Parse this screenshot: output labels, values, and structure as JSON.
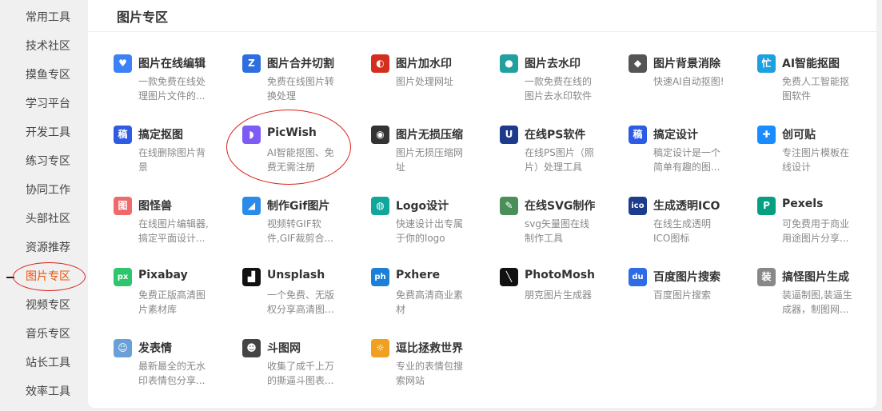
{
  "sidebar": {
    "items": [
      {
        "label": "常用工具"
      },
      {
        "label": "技术社区"
      },
      {
        "label": "摸鱼专区"
      },
      {
        "label": "学习平台"
      },
      {
        "label": "开发工具"
      },
      {
        "label": "练习专区"
      },
      {
        "label": "协同工作"
      },
      {
        "label": "头部社区"
      },
      {
        "label": "资源推荐"
      },
      {
        "label": "图片专区",
        "active": true
      },
      {
        "label": "视频专区"
      },
      {
        "label": "音乐专区"
      },
      {
        "label": "站长工具"
      },
      {
        "label": "效率工具"
      }
    ]
  },
  "panel": {
    "title": "图片专区",
    "cards": [
      {
        "name": "图片在线编辑",
        "desc": "一款免费在线处理图片文件的...",
        "icon": "heart-edit-icon",
        "color": "#3b82f6",
        "glyph": "♥"
      },
      {
        "name": "图片合并切割",
        "desc": "免费在线图片转换处理",
        "icon": "z-logo-icon",
        "color": "#2f6ede",
        "glyph": "Z"
      },
      {
        "name": "图片加水印",
        "desc": "图片处理网址",
        "icon": "red-swirl-icon",
        "color": "#d42f1e",
        "glyph": "◐"
      },
      {
        "name": "图片去水印",
        "desc": "一款免费在线的图片去水印软件",
        "icon": "water-drops-icon",
        "color": "#22a0a0",
        "glyph": "●"
      },
      {
        "name": "图片背景消除",
        "desc": "快速AI自动抠图!",
        "icon": "layers-icon",
        "color": "#555555",
        "glyph": "◆"
      },
      {
        "name": "AI智能抠图",
        "desc": "免费人工智能抠图软件",
        "icon": "ai-cutout-icon",
        "color": "#1ca0e0",
        "glyph": "忙"
      },
      {
        "name": "搞定抠图",
        "desc": "在线删除图片背景",
        "icon": "gaoding-icon",
        "color": "#2d5be3",
        "glyph": "稿"
      },
      {
        "name": "PicWish",
        "desc": "AI智能抠图、免费无需注册",
        "icon": "picwish-icon",
        "color": "#7c5cf5",
        "glyph": "◗"
      },
      {
        "name": "图片无损压缩",
        "desc": "图片无损压缩网址",
        "icon": "panda-icon",
        "color": "#333333",
        "glyph": "◉"
      },
      {
        "name": "在线PS软件",
        "desc": "在线PS图片（照片）处理工具",
        "icon": "ps-icon",
        "color": "#1e3a8a",
        "glyph": "U"
      },
      {
        "name": "搞定设计",
        "desc": "稿定设计是一个简单有趣的图...",
        "icon": "gaoding-design-icon",
        "color": "#2d5be3",
        "glyph": "稿"
      },
      {
        "name": "创可贴",
        "desc": "专注图片模板在线设计",
        "icon": "chuangkit-icon",
        "color": "#1a8cff",
        "glyph": "✚"
      },
      {
        "name": "图怪兽",
        "desc": "在线图片编辑器,搞定平面设计...",
        "icon": "tuguaishou-icon",
        "color": "#ef6b6b",
        "glyph": "图"
      },
      {
        "name": "制作Gif图片",
        "desc": "视频转GIF软件,GIF裁剪合...",
        "icon": "gif-maker-icon",
        "color": "#2b8be8",
        "glyph": "◢"
      },
      {
        "name": "Logo设计",
        "desc": "快速设计出专属于你的logo",
        "icon": "logo-design-icon",
        "color": "#10a69a",
        "glyph": "◍"
      },
      {
        "name": "在线SVG制作",
        "desc": "svg矢量图在线制作工具",
        "icon": "svg-tools-icon",
        "color": "#4a8f5a",
        "glyph": "✎"
      },
      {
        "name": "生成透明ICO",
        "desc": "在线生成透明ICO图标",
        "icon": "ico-icon",
        "color": "#1d3c8c",
        "glyph": "ico"
      },
      {
        "name": "Pexels",
        "desc": "可免费用于商业用途图片分享...",
        "icon": "pexels-icon",
        "color": "#05a081",
        "glyph": "P"
      },
      {
        "name": "Pixabay",
        "desc": "免费正版高清图片素材库",
        "icon": "pixabay-icon",
        "color": "#2ec66d",
        "glyph": "px"
      },
      {
        "name": "Unsplash",
        "desc": "一个免费、无版权分享高清图...",
        "icon": "unsplash-icon",
        "color": "#111111",
        "glyph": "▟"
      },
      {
        "name": "Pxhere",
        "desc": "免费高清商业素材",
        "icon": "pxhere-icon",
        "color": "#1c7fd8",
        "glyph": "ph"
      },
      {
        "name": "PhotoMosh",
        "desc": "朋克图片生成器",
        "icon": "photomosh-icon",
        "color": "#111111",
        "glyph": "╲"
      },
      {
        "name": "百度图片搜索",
        "desc": "百度图片搜索",
        "icon": "baidu-paw-icon",
        "color": "#2e6be6",
        "glyph": "du"
      },
      {
        "name": "搞怪图片生成",
        "desc": "装逼制图,装逼生成器，制图网...",
        "icon": "funny-maker-icon",
        "color": "#888888",
        "glyph": "装"
      },
      {
        "name": "发表情",
        "desc": "最新最全的无水印表情包分享...",
        "icon": "emoji-face-icon",
        "color": "#6aa0d8",
        "glyph": "☺"
      },
      {
        "name": "斗图网",
        "desc": "收集了成千上万的撕逼斗图表...",
        "icon": "doutu-panda-icon",
        "color": "#444444",
        "glyph": "☻"
      },
      {
        "name": "逗比拯救世界",
        "desc": "专业的表情包搜索网站",
        "icon": "doubi-icon",
        "color": "#f0a020",
        "glyph": "☼"
      }
    ]
  }
}
